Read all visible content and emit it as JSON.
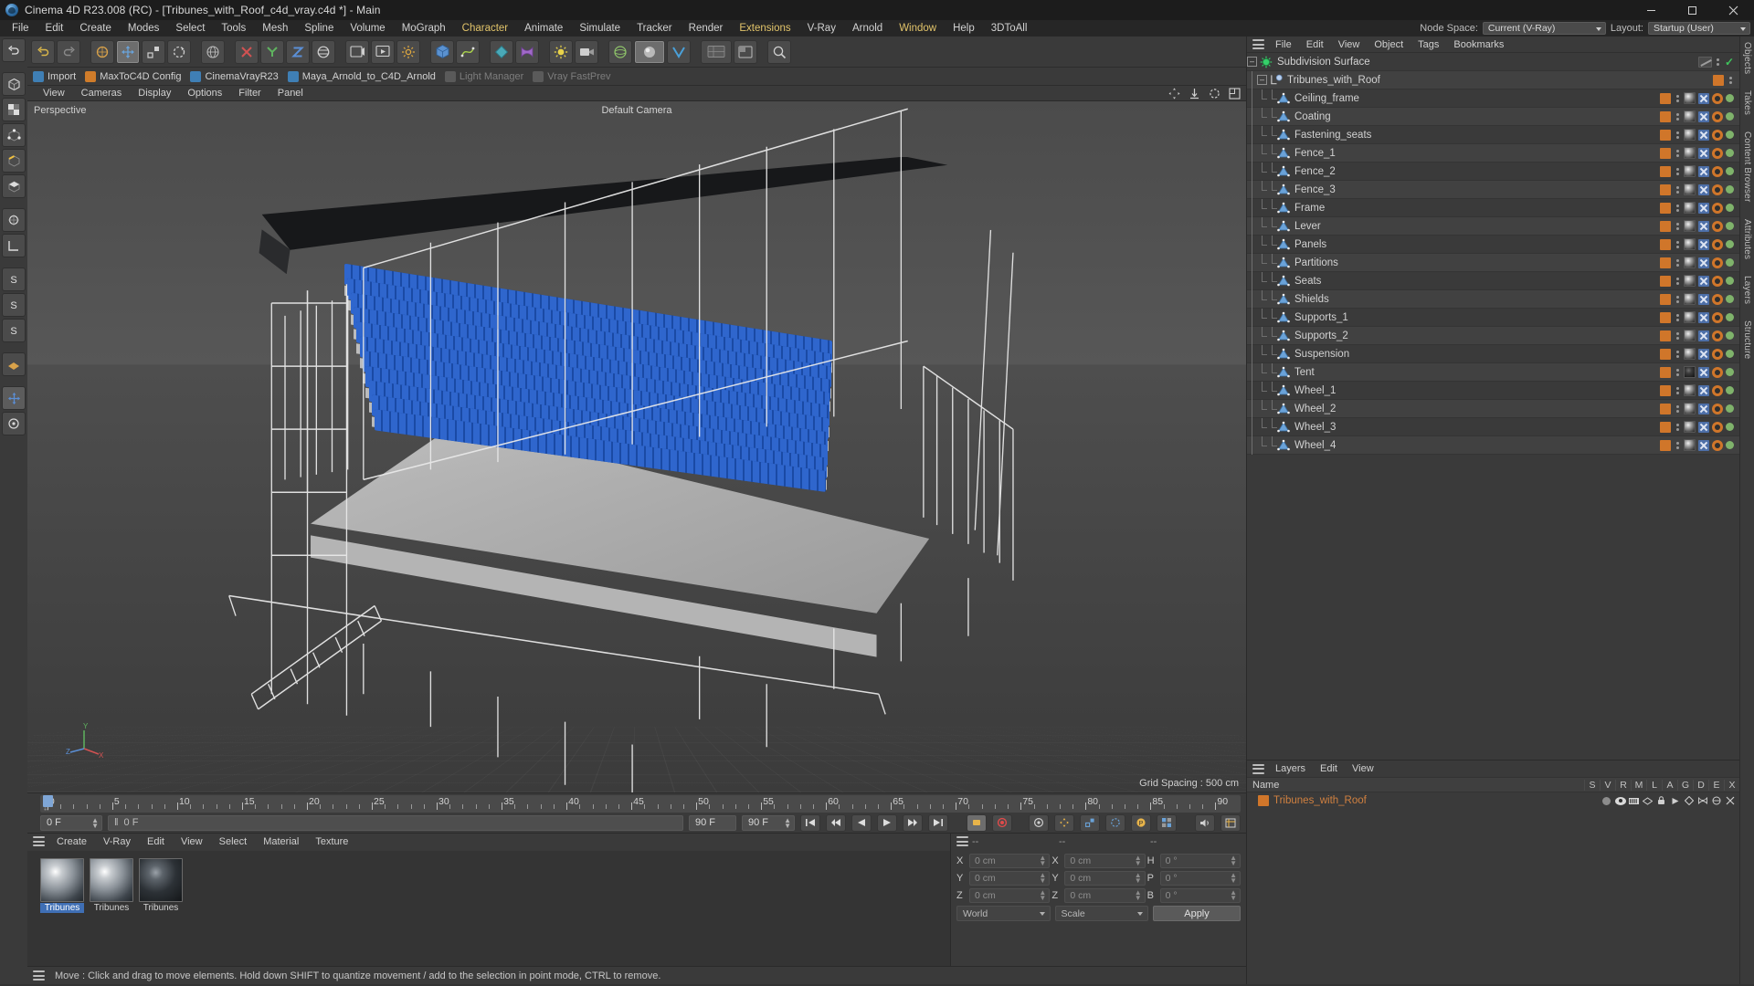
{
  "window": {
    "title": "Cinema 4D R23.008 (RC) - [Tribunes_with_Roof_c4d_vray.c4d *] - Main",
    "logo_icon": "cinema4d-logo-icon",
    "minimize_label": "─",
    "maximize_label": "❐",
    "close_label": "✕"
  },
  "menubar": {
    "items": [
      {
        "label": "File",
        "highlight": false
      },
      {
        "label": "Edit",
        "highlight": false
      },
      {
        "label": "Create",
        "highlight": false
      },
      {
        "label": "Modes",
        "highlight": false
      },
      {
        "label": "Select",
        "highlight": false
      },
      {
        "label": "Tools",
        "highlight": false
      },
      {
        "label": "Mesh",
        "highlight": false
      },
      {
        "label": "Spline",
        "highlight": false
      },
      {
        "label": "Volume",
        "highlight": false
      },
      {
        "label": "MoGraph",
        "highlight": false
      },
      {
        "label": "Character",
        "highlight": true
      },
      {
        "label": "Animate",
        "highlight": false
      },
      {
        "label": "Simulate",
        "highlight": false
      },
      {
        "label": "Tracker",
        "highlight": false
      },
      {
        "label": "Render",
        "highlight": false
      },
      {
        "label": "Extensions",
        "highlight": true
      },
      {
        "label": "V-Ray",
        "highlight": false
      },
      {
        "label": "Arnold",
        "highlight": false
      },
      {
        "label": "Window",
        "highlight": true
      },
      {
        "label": "Help",
        "highlight": false
      },
      {
        "label": "3DToAll",
        "highlight": false
      }
    ],
    "node_space_label": "Node Space:",
    "node_space_value": "Current (V-Ray)",
    "layout_label": "Layout:",
    "layout_value": "Startup (User)"
  },
  "pluginbar": {
    "items": [
      {
        "label": "Import",
        "icon": "import-icon",
        "color": "blue2",
        "dim": false
      },
      {
        "label": "MaxToC4D Config",
        "icon": "config-icon",
        "color": "orange",
        "dim": false
      },
      {
        "label": "CinemaVrayR23",
        "icon": "vray-icon",
        "color": "blue2",
        "dim": false
      },
      {
        "label": "Maya_Arnold_to_C4D_Arnold",
        "icon": "arnold-icon",
        "color": "blue2",
        "dim": false
      },
      {
        "label": "Light Manager",
        "icon": "light-manager-icon",
        "color": "grey",
        "dim": true
      },
      {
        "label": "Vray FastPrev",
        "icon": "vray-fastprev-icon",
        "color": "grey",
        "dim": true
      }
    ]
  },
  "viewport": {
    "menu": [
      "View",
      "Cameras",
      "Display",
      "Options",
      "Filter",
      "Panel"
    ],
    "perspective_label": "Perspective",
    "camera_label": "Default Camera",
    "grid_spacing": "Grid Spacing : 500 cm",
    "axis": {
      "x": "X",
      "y": "Y",
      "z": "Z"
    },
    "corner_icons": [
      "move-view-icon",
      "zoom-view-icon",
      "rotate-view-icon",
      "maximize-view-icon"
    ]
  },
  "timeline": {
    "ticks": [
      0,
      5,
      10,
      15,
      20,
      25,
      30,
      35,
      40,
      45,
      50,
      55,
      60,
      65,
      70,
      75,
      80,
      85,
      90
    ],
    "current_frame_field": "0 F",
    "current_frame_secondary": "0 F",
    "end_frame_field": "90 F",
    "preview_range_field": "90 F",
    "frame_right_field": "0 F",
    "transport_icons": [
      "go-to-start-icon",
      "step-back-icon",
      "play-back-icon",
      "play-icon",
      "step-forward-icon",
      "go-to-end-icon",
      "next-key-icon"
    ],
    "record_icons": [
      "record-active-icon",
      "record-icon",
      "autokey-icon",
      "position-key-icon",
      "scale-key-icon",
      "rotation-key-icon",
      "param-key-icon",
      "pla-key-icon"
    ],
    "extra_icons": [
      "sound-icon",
      "layout-icon"
    ]
  },
  "material_manager": {
    "menu": [
      "Create",
      "V-Ray",
      "Edit",
      "View",
      "Select",
      "Material",
      "Texture"
    ],
    "materials": [
      {
        "name": "Tribunes",
        "selected": true,
        "dark": false
      },
      {
        "name": "Tribunes",
        "selected": false,
        "dark": false
      },
      {
        "name": "Tribunes",
        "selected": false,
        "dark": true
      }
    ]
  },
  "coordinates": {
    "header_dashes": [
      "--",
      "--",
      "--"
    ],
    "rows": [
      {
        "label1": "X",
        "value1": "0 cm",
        "label2": "X",
        "value2": "0 cm",
        "label3": "H",
        "value3": "0 °"
      },
      {
        "label1": "Y",
        "value1": "0 cm",
        "label2": "Y",
        "value2": "0 cm",
        "label3": "P",
        "value3": "0 °"
      },
      {
        "label1": "Z",
        "value1": "0 cm",
        "label2": "Z",
        "value2": "0 cm",
        "label3": "B",
        "value3": "0 °"
      }
    ],
    "system_select": "World",
    "mode_select": "Scale",
    "apply_button": "Apply"
  },
  "object_manager": {
    "menu": [
      "File",
      "Edit",
      "View",
      "Object",
      "Tags",
      "Bookmarks"
    ],
    "items": [
      {
        "name": "Subdivision Surface",
        "depth": 0,
        "icon": "subdivision-surface-icon",
        "expander": true,
        "tagtype": "subdiv"
      },
      {
        "name": "Tribunes_with_Roof",
        "depth": 1,
        "icon": "null-object-icon",
        "expander": true,
        "tagtype": "parent"
      },
      {
        "name": "Ceiling_frame",
        "depth": 2,
        "icon": "polygon-object-icon",
        "expander": false,
        "tagtype": "mesh"
      },
      {
        "name": "Coating",
        "depth": 2,
        "icon": "polygon-object-icon",
        "expander": false,
        "tagtype": "mesh"
      },
      {
        "name": "Fastening_seats",
        "depth": 2,
        "icon": "polygon-object-icon",
        "expander": false,
        "tagtype": "mesh"
      },
      {
        "name": "Fence_1",
        "depth": 2,
        "icon": "polygon-object-icon",
        "expander": false,
        "tagtype": "mesh"
      },
      {
        "name": "Fence_2",
        "depth": 2,
        "icon": "polygon-object-icon",
        "expander": false,
        "tagtype": "mesh"
      },
      {
        "name": "Fence_3",
        "depth": 2,
        "icon": "polygon-object-icon",
        "expander": false,
        "tagtype": "mesh"
      },
      {
        "name": "Frame",
        "depth": 2,
        "icon": "polygon-object-icon",
        "expander": false,
        "tagtype": "mesh"
      },
      {
        "name": "Lever",
        "depth": 2,
        "icon": "polygon-object-icon",
        "expander": false,
        "tagtype": "mesh"
      },
      {
        "name": "Panels",
        "depth": 2,
        "icon": "polygon-object-icon",
        "expander": false,
        "tagtype": "mesh"
      },
      {
        "name": "Partitions",
        "depth": 2,
        "icon": "polygon-object-icon",
        "expander": false,
        "tagtype": "mesh"
      },
      {
        "name": "Seats",
        "depth": 2,
        "icon": "polygon-object-icon",
        "expander": false,
        "tagtype": "mesh"
      },
      {
        "name": "Shields",
        "depth": 2,
        "icon": "polygon-object-icon",
        "expander": false,
        "tagtype": "mesh"
      },
      {
        "name": "Supports_1",
        "depth": 2,
        "icon": "polygon-object-icon",
        "expander": false,
        "tagtype": "mesh"
      },
      {
        "name": "Supports_2",
        "depth": 2,
        "icon": "polygon-object-icon",
        "expander": false,
        "tagtype": "mesh"
      },
      {
        "name": "Suspension",
        "depth": 2,
        "icon": "polygon-object-icon",
        "expander": false,
        "tagtype": "mesh"
      },
      {
        "name": "Tent",
        "depth": 2,
        "icon": "polygon-object-icon",
        "expander": false,
        "tagtype": "mesh-dark"
      },
      {
        "name": "Wheel_1",
        "depth": 2,
        "icon": "polygon-object-icon",
        "expander": false,
        "tagtype": "mesh"
      },
      {
        "name": "Wheel_2",
        "depth": 2,
        "icon": "polygon-object-icon",
        "expander": false,
        "tagtype": "mesh"
      },
      {
        "name": "Wheel_3",
        "depth": 2,
        "icon": "polygon-object-icon",
        "expander": false,
        "tagtype": "mesh"
      },
      {
        "name": "Wheel_4",
        "depth": 2,
        "icon": "polygon-object-icon",
        "expander": false,
        "tagtype": "mesh"
      }
    ]
  },
  "layer_manager": {
    "menu": [
      "Layers",
      "Edit",
      "View"
    ],
    "columns": [
      "Name",
      "S",
      "V",
      "R",
      "M",
      "L",
      "A",
      "G",
      "D",
      "E",
      "X"
    ],
    "rows": [
      {
        "name": "Tribunes_with_Roof",
        "color": "#d0762a"
      }
    ]
  },
  "right_tabs": [
    "Objects",
    "Takes",
    "Content Browser",
    "Attributes",
    "Layers",
    "Structure"
  ],
  "statusbar": {
    "message": "Move : Click and drag to move elements. Hold down SHIFT to quantize movement / add to the selection in point mode, CTRL to remove."
  },
  "colors": {
    "accent_orange": "#d0762a",
    "accent_blue": "#6aa2d8",
    "seat_blue": "#1f55b5",
    "panel_bg": "#3a3a3a",
    "titlebar_bg": "#1c1c1c",
    "menu_highlight": "#e2c46a",
    "tick_green": "#3fc45c"
  }
}
